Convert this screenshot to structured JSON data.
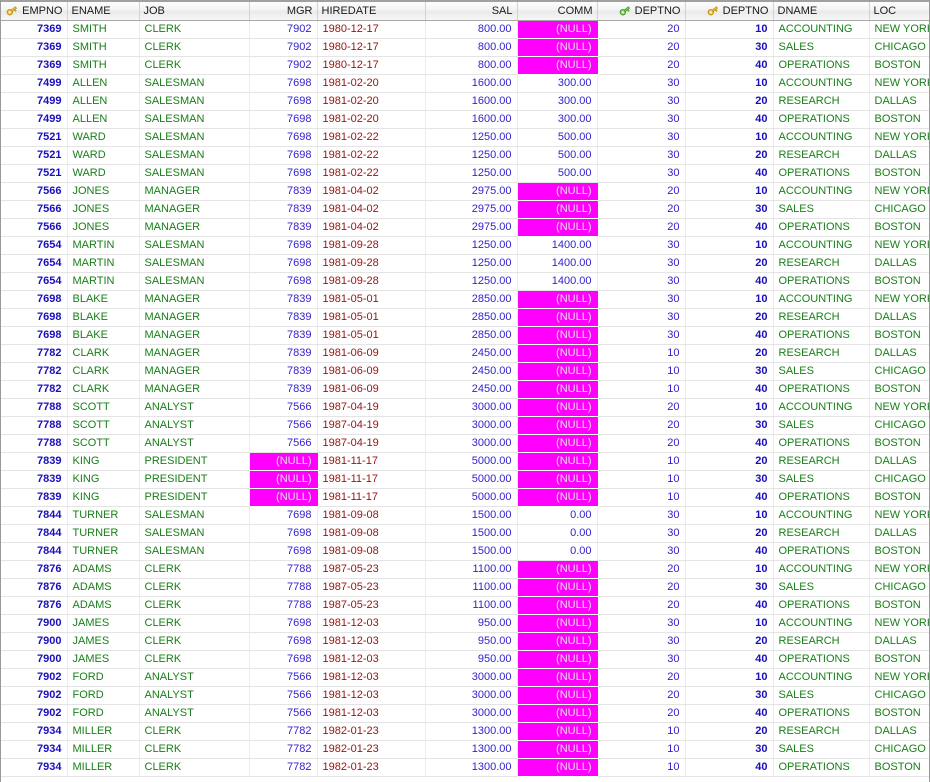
{
  "grid": {
    "columns": [
      {
        "key": "empno",
        "label": "EMPNO",
        "align": "right",
        "icon": "gold-key-icon",
        "style": "numkey"
      },
      {
        "key": "ename",
        "label": "ENAME",
        "align": "left",
        "icon": null,
        "style": "txt"
      },
      {
        "key": "job",
        "label": "JOB",
        "align": "left",
        "icon": null,
        "style": "txt"
      },
      {
        "key": "mgr",
        "label": "MGR",
        "align": "right",
        "icon": null,
        "style": "num"
      },
      {
        "key": "hiredate",
        "label": "HIREDATE",
        "align": "left",
        "icon": null,
        "style": "date"
      },
      {
        "key": "sal",
        "label": "SAL",
        "align": "right",
        "icon": null,
        "style": "num"
      },
      {
        "key": "comm",
        "label": "COMM",
        "align": "right",
        "icon": null,
        "style": "num"
      },
      {
        "key": "deptno1",
        "label": "DEPTNO",
        "align": "right",
        "icon": "green-key-icon",
        "style": "num"
      },
      {
        "key": "deptno2",
        "label": "DEPTNO",
        "align": "right",
        "icon": "gold-key-icon",
        "style": "numkey"
      },
      {
        "key": "dname",
        "label": "DNAME",
        "align": "left",
        "icon": null,
        "style": "txt"
      },
      {
        "key": "loc",
        "label": "LOC",
        "align": "left",
        "icon": null,
        "style": "txt"
      }
    ],
    "null_text": "(NULL)",
    "colors": {
      "null_background": "#ff00ff",
      "null_text": "#e2e2e2",
      "number": "#3322cc",
      "primary_key_number": "#1a0fbe",
      "text": "#178017",
      "date": "#9a1111",
      "header_text": "#1b1b1b",
      "grid_line": "#e4e4e4",
      "border": "#9a9a9a"
    },
    "rows": [
      [
        "7369",
        "SMITH",
        "CLERK",
        "7902",
        "1980-12-17",
        "800.00",
        null,
        "20",
        "10",
        "ACCOUNTING",
        "NEW YORK"
      ],
      [
        "7369",
        "SMITH",
        "CLERK",
        "7902",
        "1980-12-17",
        "800.00",
        null,
        "20",
        "30",
        "SALES",
        "CHICAGO"
      ],
      [
        "7369",
        "SMITH",
        "CLERK",
        "7902",
        "1980-12-17",
        "800.00",
        null,
        "20",
        "40",
        "OPERATIONS",
        "BOSTON"
      ],
      [
        "7499",
        "ALLEN",
        "SALESMAN",
        "7698",
        "1981-02-20",
        "1600.00",
        "300.00",
        "30",
        "10",
        "ACCOUNTING",
        "NEW YORK"
      ],
      [
        "7499",
        "ALLEN",
        "SALESMAN",
        "7698",
        "1981-02-20",
        "1600.00",
        "300.00",
        "30",
        "20",
        "RESEARCH",
        "DALLAS"
      ],
      [
        "7499",
        "ALLEN",
        "SALESMAN",
        "7698",
        "1981-02-20",
        "1600.00",
        "300.00",
        "30",
        "40",
        "OPERATIONS",
        "BOSTON"
      ],
      [
        "7521",
        "WARD",
        "SALESMAN",
        "7698",
        "1981-02-22",
        "1250.00",
        "500.00",
        "30",
        "10",
        "ACCOUNTING",
        "NEW YORK"
      ],
      [
        "7521",
        "WARD",
        "SALESMAN",
        "7698",
        "1981-02-22",
        "1250.00",
        "500.00",
        "30",
        "20",
        "RESEARCH",
        "DALLAS"
      ],
      [
        "7521",
        "WARD",
        "SALESMAN",
        "7698",
        "1981-02-22",
        "1250.00",
        "500.00",
        "30",
        "40",
        "OPERATIONS",
        "BOSTON"
      ],
      [
        "7566",
        "JONES",
        "MANAGER",
        "7839",
        "1981-04-02",
        "2975.00",
        null,
        "20",
        "10",
        "ACCOUNTING",
        "NEW YORK"
      ],
      [
        "7566",
        "JONES",
        "MANAGER",
        "7839",
        "1981-04-02",
        "2975.00",
        null,
        "20",
        "30",
        "SALES",
        "CHICAGO"
      ],
      [
        "7566",
        "JONES",
        "MANAGER",
        "7839",
        "1981-04-02",
        "2975.00",
        null,
        "20",
        "40",
        "OPERATIONS",
        "BOSTON"
      ],
      [
        "7654",
        "MARTIN",
        "SALESMAN",
        "7698",
        "1981-09-28",
        "1250.00",
        "1400.00",
        "30",
        "10",
        "ACCOUNTING",
        "NEW YORK"
      ],
      [
        "7654",
        "MARTIN",
        "SALESMAN",
        "7698",
        "1981-09-28",
        "1250.00",
        "1400.00",
        "30",
        "20",
        "RESEARCH",
        "DALLAS"
      ],
      [
        "7654",
        "MARTIN",
        "SALESMAN",
        "7698",
        "1981-09-28",
        "1250.00",
        "1400.00",
        "30",
        "40",
        "OPERATIONS",
        "BOSTON"
      ],
      [
        "7698",
        "BLAKE",
        "MANAGER",
        "7839",
        "1981-05-01",
        "2850.00",
        null,
        "30",
        "10",
        "ACCOUNTING",
        "NEW YORK"
      ],
      [
        "7698",
        "BLAKE",
        "MANAGER",
        "7839",
        "1981-05-01",
        "2850.00",
        null,
        "30",
        "20",
        "RESEARCH",
        "DALLAS"
      ],
      [
        "7698",
        "BLAKE",
        "MANAGER",
        "7839",
        "1981-05-01",
        "2850.00",
        null,
        "30",
        "40",
        "OPERATIONS",
        "BOSTON"
      ],
      [
        "7782",
        "CLARK",
        "MANAGER",
        "7839",
        "1981-06-09",
        "2450.00",
        null,
        "10",
        "20",
        "RESEARCH",
        "DALLAS"
      ],
      [
        "7782",
        "CLARK",
        "MANAGER",
        "7839",
        "1981-06-09",
        "2450.00",
        null,
        "10",
        "30",
        "SALES",
        "CHICAGO"
      ],
      [
        "7782",
        "CLARK",
        "MANAGER",
        "7839",
        "1981-06-09",
        "2450.00",
        null,
        "10",
        "40",
        "OPERATIONS",
        "BOSTON"
      ],
      [
        "7788",
        "SCOTT",
        "ANALYST",
        "7566",
        "1987-04-19",
        "3000.00",
        null,
        "20",
        "10",
        "ACCOUNTING",
        "NEW YORK"
      ],
      [
        "7788",
        "SCOTT",
        "ANALYST",
        "7566",
        "1987-04-19",
        "3000.00",
        null,
        "20",
        "30",
        "SALES",
        "CHICAGO"
      ],
      [
        "7788",
        "SCOTT",
        "ANALYST",
        "7566",
        "1987-04-19",
        "3000.00",
        null,
        "20",
        "40",
        "OPERATIONS",
        "BOSTON"
      ],
      [
        "7839",
        "KING",
        "PRESIDENT",
        null,
        "1981-11-17",
        "5000.00",
        null,
        "10",
        "20",
        "RESEARCH",
        "DALLAS"
      ],
      [
        "7839",
        "KING",
        "PRESIDENT",
        null,
        "1981-11-17",
        "5000.00",
        null,
        "10",
        "30",
        "SALES",
        "CHICAGO"
      ],
      [
        "7839",
        "KING",
        "PRESIDENT",
        null,
        "1981-11-17",
        "5000.00",
        null,
        "10",
        "40",
        "OPERATIONS",
        "BOSTON"
      ],
      [
        "7844",
        "TURNER",
        "SALESMAN",
        "7698",
        "1981-09-08",
        "1500.00",
        "0.00",
        "30",
        "10",
        "ACCOUNTING",
        "NEW YORK"
      ],
      [
        "7844",
        "TURNER",
        "SALESMAN",
        "7698",
        "1981-09-08",
        "1500.00",
        "0.00",
        "30",
        "20",
        "RESEARCH",
        "DALLAS"
      ],
      [
        "7844",
        "TURNER",
        "SALESMAN",
        "7698",
        "1981-09-08",
        "1500.00",
        "0.00",
        "30",
        "40",
        "OPERATIONS",
        "BOSTON"
      ],
      [
        "7876",
        "ADAMS",
        "CLERK",
        "7788",
        "1987-05-23",
        "1100.00",
        null,
        "20",
        "10",
        "ACCOUNTING",
        "NEW YORK"
      ],
      [
        "7876",
        "ADAMS",
        "CLERK",
        "7788",
        "1987-05-23",
        "1100.00",
        null,
        "20",
        "30",
        "SALES",
        "CHICAGO"
      ],
      [
        "7876",
        "ADAMS",
        "CLERK",
        "7788",
        "1987-05-23",
        "1100.00",
        null,
        "20",
        "40",
        "OPERATIONS",
        "BOSTON"
      ],
      [
        "7900",
        "JAMES",
        "CLERK",
        "7698",
        "1981-12-03",
        "950.00",
        null,
        "30",
        "10",
        "ACCOUNTING",
        "NEW YORK"
      ],
      [
        "7900",
        "JAMES",
        "CLERK",
        "7698",
        "1981-12-03",
        "950.00",
        null,
        "30",
        "20",
        "RESEARCH",
        "DALLAS"
      ],
      [
        "7900",
        "JAMES",
        "CLERK",
        "7698",
        "1981-12-03",
        "950.00",
        null,
        "30",
        "40",
        "OPERATIONS",
        "BOSTON"
      ],
      [
        "7902",
        "FORD",
        "ANALYST",
        "7566",
        "1981-12-03",
        "3000.00",
        null,
        "20",
        "10",
        "ACCOUNTING",
        "NEW YORK"
      ],
      [
        "7902",
        "FORD",
        "ANALYST",
        "7566",
        "1981-12-03",
        "3000.00",
        null,
        "20",
        "30",
        "SALES",
        "CHICAGO"
      ],
      [
        "7902",
        "FORD",
        "ANALYST",
        "7566",
        "1981-12-03",
        "3000.00",
        null,
        "20",
        "40",
        "OPERATIONS",
        "BOSTON"
      ],
      [
        "7934",
        "MILLER",
        "CLERK",
        "7782",
        "1982-01-23",
        "1300.00",
        null,
        "10",
        "20",
        "RESEARCH",
        "DALLAS"
      ],
      [
        "7934",
        "MILLER",
        "CLERK",
        "7782",
        "1982-01-23",
        "1300.00",
        null,
        "10",
        "30",
        "SALES",
        "CHICAGO"
      ],
      [
        "7934",
        "MILLER",
        "CLERK",
        "7782",
        "1982-01-23",
        "1300.00",
        null,
        "10",
        "40",
        "OPERATIONS",
        "BOSTON"
      ]
    ]
  }
}
